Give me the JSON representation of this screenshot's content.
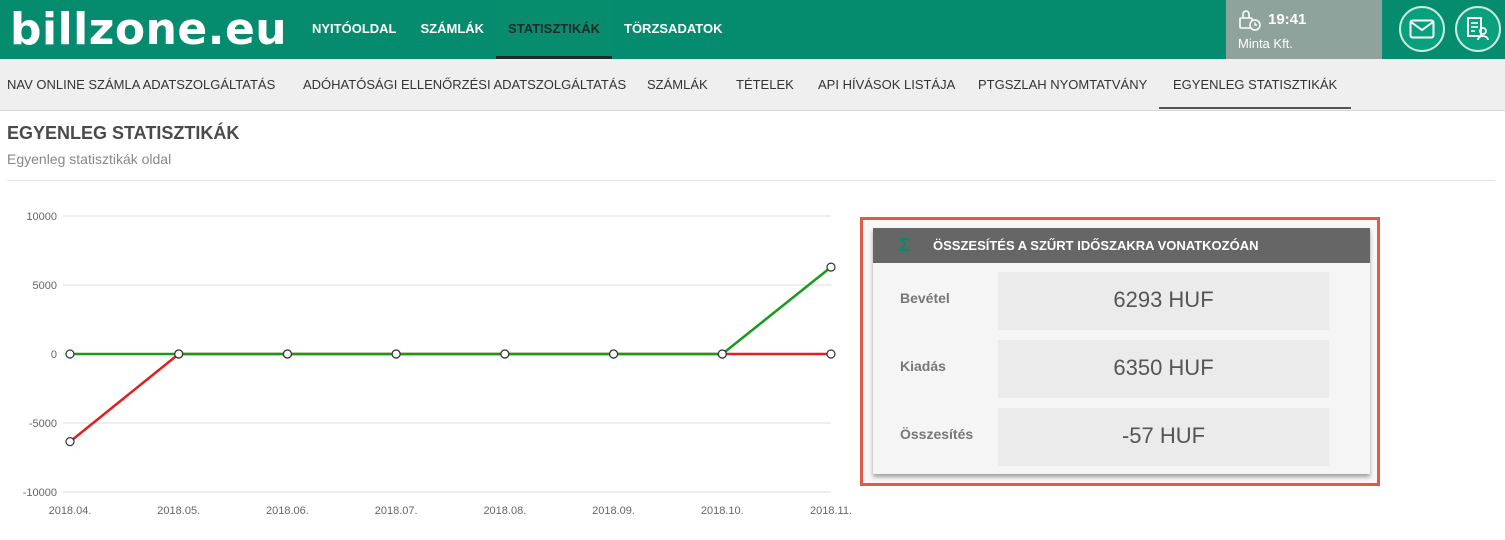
{
  "brand": {
    "logo": "billzone.eu"
  },
  "main_nav": [
    {
      "label": "NYITÓOLDAL"
    },
    {
      "label": "SZÁMLÁK"
    },
    {
      "label": "STATISZTIKÁK"
    },
    {
      "label": "TÖRZSADATOK"
    }
  ],
  "user": {
    "time": "19:41",
    "company": "Minta Kft."
  },
  "sub_nav": [
    {
      "label": "NAV ONLINE SZÁMLA ADATSZOLGÁLTATÁS"
    },
    {
      "label": "ADÓHATÓSÁGI ELLENŐRZÉSI ADATSZOLGÁLTATÁS"
    },
    {
      "label": "SZÁMLÁK"
    },
    {
      "label": "TÉTELEK"
    },
    {
      "label": "API HÍVÁSOK LISTÁJA"
    },
    {
      "label": "PTGSZLAH NYOMTATVÁNY"
    },
    {
      "label": "EGYENLEG STATISZTIKÁK"
    }
  ],
  "page": {
    "title": "EGYENLEG STATISZTIKÁK",
    "subtitle": "Egyenleg statisztikák oldal"
  },
  "summary": {
    "header": "ÖSSZESÍTÉS A SZŰRT IDŐSZAKRA VONATKOZÓAN",
    "rows": [
      {
        "label": "Bevétel",
        "value": "6293 HUF"
      },
      {
        "label": "Kiadás",
        "value": "6350 HUF"
      },
      {
        "label": "Összesítés",
        "value": "-57 HUF"
      }
    ]
  },
  "colors": {
    "primary": "#058b6d",
    "income": "#1a9a1a",
    "expense": "#e02020",
    "highlight": "#e05a4a"
  },
  "chart_data": {
    "type": "line",
    "x": [
      "2018.04.",
      "2018.05.",
      "2018.06.",
      "2018.07.",
      "2018.08.",
      "2018.09.",
      "2018.10.",
      "2018.11."
    ],
    "y_ticks": [
      10000,
      5000,
      0,
      -5000,
      -10000
    ],
    "ylim": [
      -10000,
      10000
    ],
    "grid": true,
    "series": [
      {
        "color": "#e02020",
        "values": [
          -6350,
          0,
          0,
          0,
          0,
          0,
          0,
          0
        ]
      },
      {
        "color": "#1a9a1a",
        "values": [
          0,
          0,
          0,
          0,
          0,
          0,
          0,
          6293
        ]
      }
    ]
  }
}
